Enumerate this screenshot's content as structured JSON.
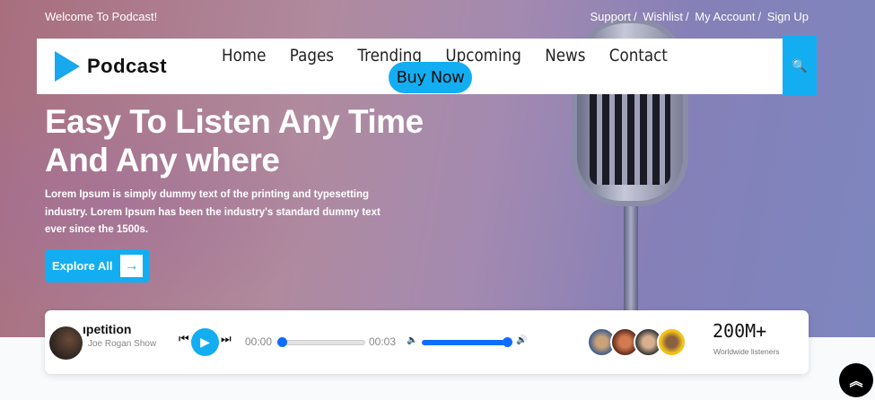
{
  "topbar": {
    "welcome": "Welcome To Podcast!",
    "links": [
      "Support",
      "Wishlist",
      "My Account",
      "Sign Up"
    ],
    "sep": "/"
  },
  "nav": {
    "brand": "Podcast",
    "items": [
      "Home",
      "Pages",
      "Trending",
      "Upcoming",
      "News",
      "Contact"
    ],
    "buy_now": "Buy Now",
    "search_icon": "🔍"
  },
  "hero": {
    "title_line1": "Easy To Listen Any Time",
    "title_line2": "And Any where",
    "text": "Lorem Ipsum is simply dummy text of the printing and typesetting industry. Lorem Ipsum has been the industry's standard dummy text ever since the 1500s.",
    "cta": "Explore All",
    "cta_icon": "→"
  },
  "player": {
    "title": "ıpetition",
    "show": "Joe Rogan Show",
    "prev": "⏮",
    "play": "▶",
    "next": "⏭",
    "current": "00:00",
    "duration": "00:03",
    "progress": 0,
    "volume": 1,
    "vol_low": "🔈",
    "vol_high": "🔊"
  },
  "stats": {
    "count": "200M+",
    "label": "Worldwide listeners"
  },
  "totop": "︽",
  "colors": {
    "accent": "#13aef2",
    "slider": "#0d6efd"
  }
}
